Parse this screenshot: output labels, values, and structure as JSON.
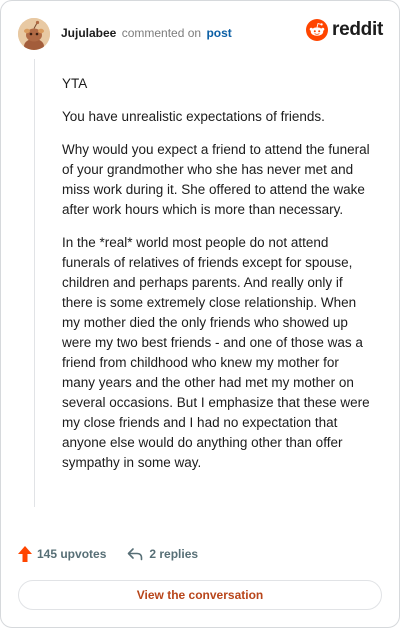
{
  "comment": {
    "username": "Jujulabee",
    "action_text": "commented on",
    "target_link": "post",
    "paragraphs": [
      "YTA",
      "You have unrealistic expectations of friends.",
      "Why would you expect a friend to attend the funeral of your grandmother who she has never met and miss work during it. She offered to attend the wake after work hours which is more than necessary.",
      "In the *real* world most people do not attend funerals of relatives of friends except for spouse, children and perhaps parents. And really only if there is some extremely close relationship. When my mother died the only friends who showed up were my two best friends - and one of those was a friend from childhood who knew my mother for many years and the other had met my mother on several occasions. But I emphasize that these were my close friends and I had no expectation that anyone else would do anything other than offer sympathy in some way."
    ]
  },
  "brand": {
    "name": "reddit",
    "color": "#ff4500",
    "icon": "reddit-logo-icon"
  },
  "actions": {
    "upvotes_label": "145 upvotes",
    "replies_label": "2 replies",
    "upvote_icon": "upvote-arrow-icon",
    "reply_icon": "reply-arrow-icon",
    "upvote_color": "#ff4500"
  },
  "cta": {
    "label": "View the conversation",
    "color": "#b8451a"
  }
}
